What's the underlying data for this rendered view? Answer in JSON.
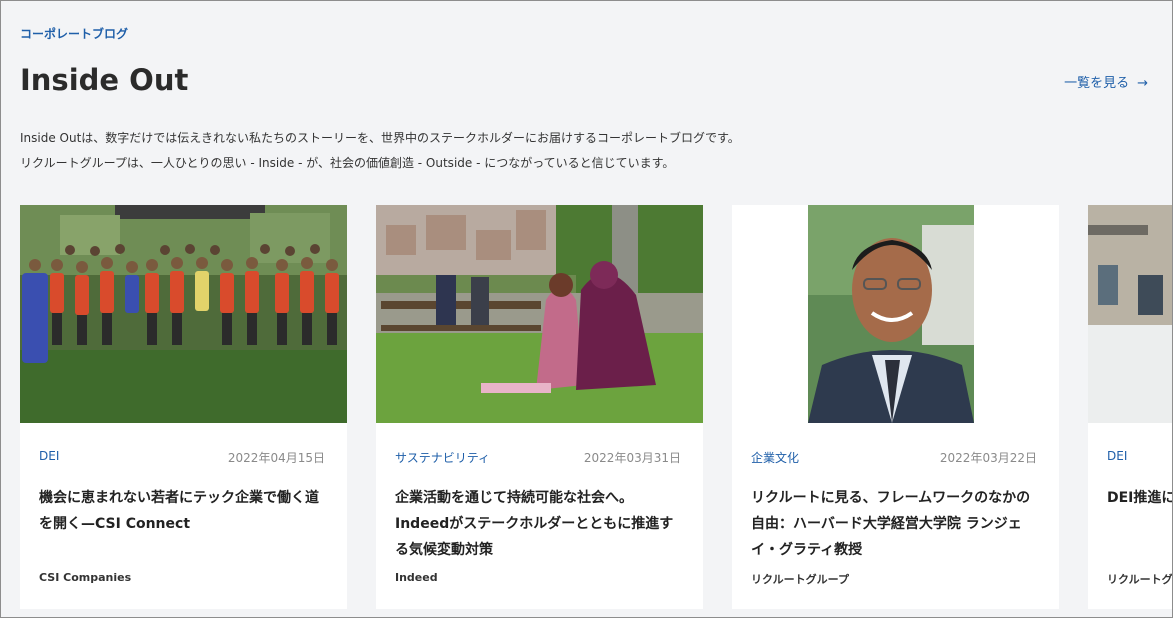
{
  "header": {
    "eyebrow": "コーポレートブログ",
    "title": "Inside Out",
    "view_all": "一覧を見る",
    "view_all_arrow": "→"
  },
  "description": {
    "line1": "Inside Outは、数字だけでは伝えきれない私たちのストーリーを、世界中のステークホルダーにお届けするコーポレートブログです。",
    "line2": "リクルートグループは、一人ひとりの思い - Inside - が、社会の価値創造 - Outside - につながっていると信じています。"
  },
  "cards": [
    {
      "category": "DEI",
      "date": "2022年04月15日",
      "title": "機会に恵まれない若者にテック企業で働く道を開く—CSI Connect",
      "author": "CSI Companies",
      "image": "group-photo"
    },
    {
      "category": "サステナビリティ",
      "date": "2022年03月31日",
      "title": "企業活動を通じて持続可能な社会へ。Indeedがステークホルダーとともに推進する気候変動対策",
      "author": "Indeed",
      "image": "park-photo"
    },
    {
      "category": "企業文化",
      "date": "2022年03月22日",
      "title": "リクルートに見る、フレームワークのなかの自由：ハーバード大学経営大学院 ランジェイ・グラティ教授",
      "author": "リクルートグループ",
      "image": "portrait-photo"
    },
    {
      "category": "DEI",
      "date": "",
      "title": "DEI推進に",
      "author": "リクルートグ",
      "image": "office-photo"
    }
  ],
  "colors": {
    "accent": "#1f5fa9",
    "background": "#f3f4f6",
    "card": "#ffffff"
  }
}
